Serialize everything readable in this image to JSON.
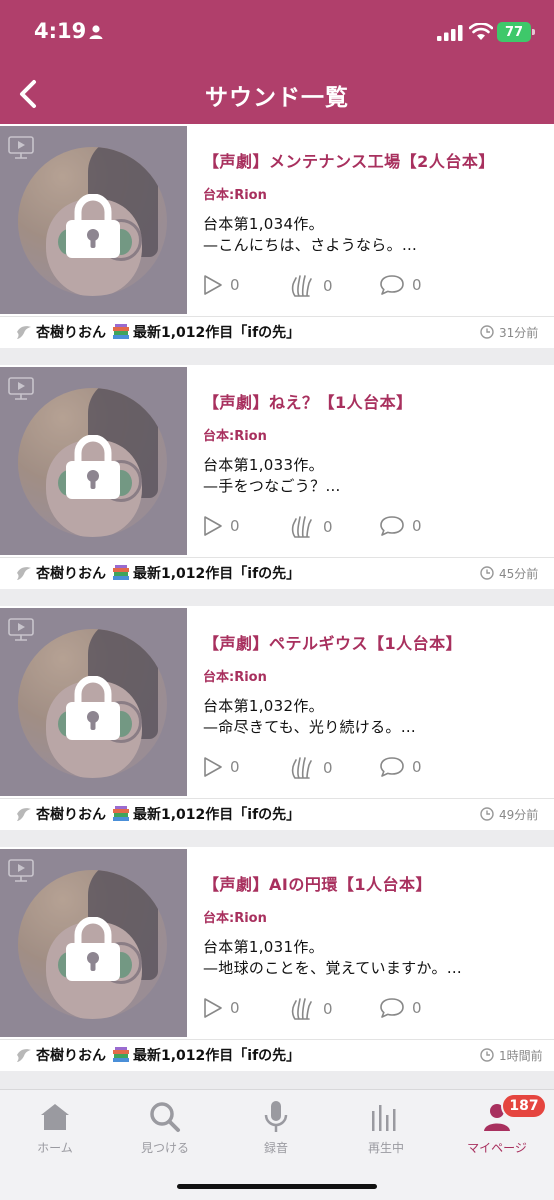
{
  "status_bar": {
    "time": "4:19",
    "battery": "77"
  },
  "header": {
    "title": "サウンド一覧"
  },
  "items": [
    {
      "title": "【声劇】メンテナンス工場【2人台本】",
      "author": "台本:Rion",
      "desc_line1": "台本第1,034作。",
      "desc_line2": "—こんにちは、さようなら。…",
      "plays": "0",
      "claps": "0",
      "comments": "0",
      "owner": "杏樹りおん",
      "latest": "最新1,012作目「ifの先」",
      "time_ago": "31分前"
    },
    {
      "title": "【声劇】ねえ？【1人台本】",
      "author": "台本:Rion",
      "desc_line1": "台本第1,033作。",
      "desc_line2": "—手をつなごう？…",
      "plays": "0",
      "claps": "0",
      "comments": "0",
      "owner": "杏樹りおん",
      "latest": "最新1,012作目「ifの先」",
      "time_ago": "45分前"
    },
    {
      "title": "【声劇】ペテルギウス【1人台本】",
      "author": "台本:Rion",
      "desc_line1": "台本第1,032作。",
      "desc_line2": "—命尽きても、光り続ける。…",
      "plays": "0",
      "claps": "0",
      "comments": "0",
      "owner": "杏樹りおん",
      "latest": "最新1,012作目「ifの先」",
      "time_ago": "49分前"
    },
    {
      "title": "【声劇】AIの円環【1人台本】",
      "author": "台本:Rion",
      "desc_line1": "台本第1,031作。",
      "desc_line2": "—地球のことを、覚えていますか。…",
      "plays": "0",
      "claps": "0",
      "comments": "0",
      "owner": "杏樹りおん",
      "latest": "最新1,012作目「ifの先」",
      "time_ago": "1時間前"
    }
  ],
  "tabs": [
    {
      "label": "ホーム",
      "icon": "home-icon"
    },
    {
      "label": "見つける",
      "icon": "search-icon"
    },
    {
      "label": "録音",
      "icon": "microphone-icon"
    },
    {
      "label": "再生中",
      "icon": "equalizer-icon"
    },
    {
      "label": "マイページ",
      "icon": "person-icon"
    }
  ],
  "mypage_badge": "187",
  "colors": {
    "brand": "#b03f6b",
    "accent_text": "#a8305e",
    "badge": "#e5453f"
  }
}
